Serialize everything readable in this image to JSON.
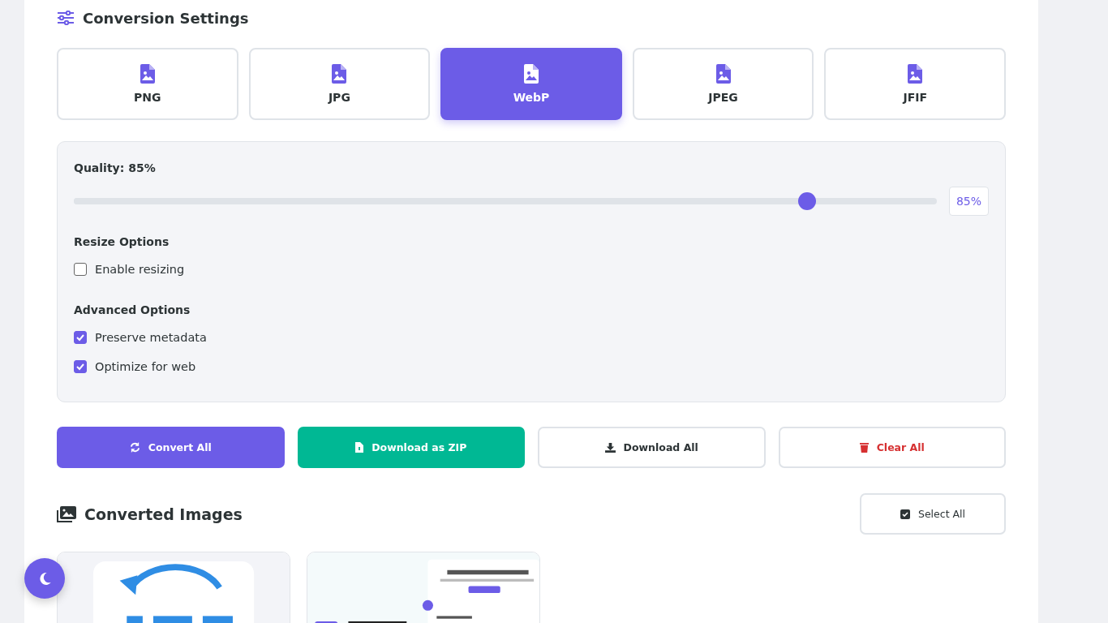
{
  "settings": {
    "title": "Conversion Settings",
    "formats": [
      {
        "label": "PNG",
        "selected": false
      },
      {
        "label": "JPG",
        "selected": false
      },
      {
        "label": "WebP",
        "selected": true
      },
      {
        "label": "JPEG",
        "selected": false
      },
      {
        "label": "JFIF",
        "selected": false
      }
    ],
    "quality": {
      "label": "Quality: 85%",
      "level": 0.85,
      "reading": "85%"
    },
    "resize": {
      "heading": "Resize Options",
      "options": [
        {
          "label": "Enable resizing",
          "checked": false
        }
      ]
    },
    "advanced": {
      "heading": "Advanced Options",
      "options": [
        {
          "label": "Preserve metadata",
          "checked": true
        },
        {
          "label": "Optimize for web",
          "checked": true
        }
      ]
    }
  },
  "actions": [
    {
      "label": "Convert All",
      "kind": "convert"
    },
    {
      "label": "Download as ZIP",
      "kind": "zip"
    },
    {
      "label": "Download All",
      "kind": "download"
    },
    {
      "label": "Clear All",
      "kind": "clear"
    }
  ],
  "converted": {
    "title": "Converted Images",
    "select_all": "Select All"
  }
}
